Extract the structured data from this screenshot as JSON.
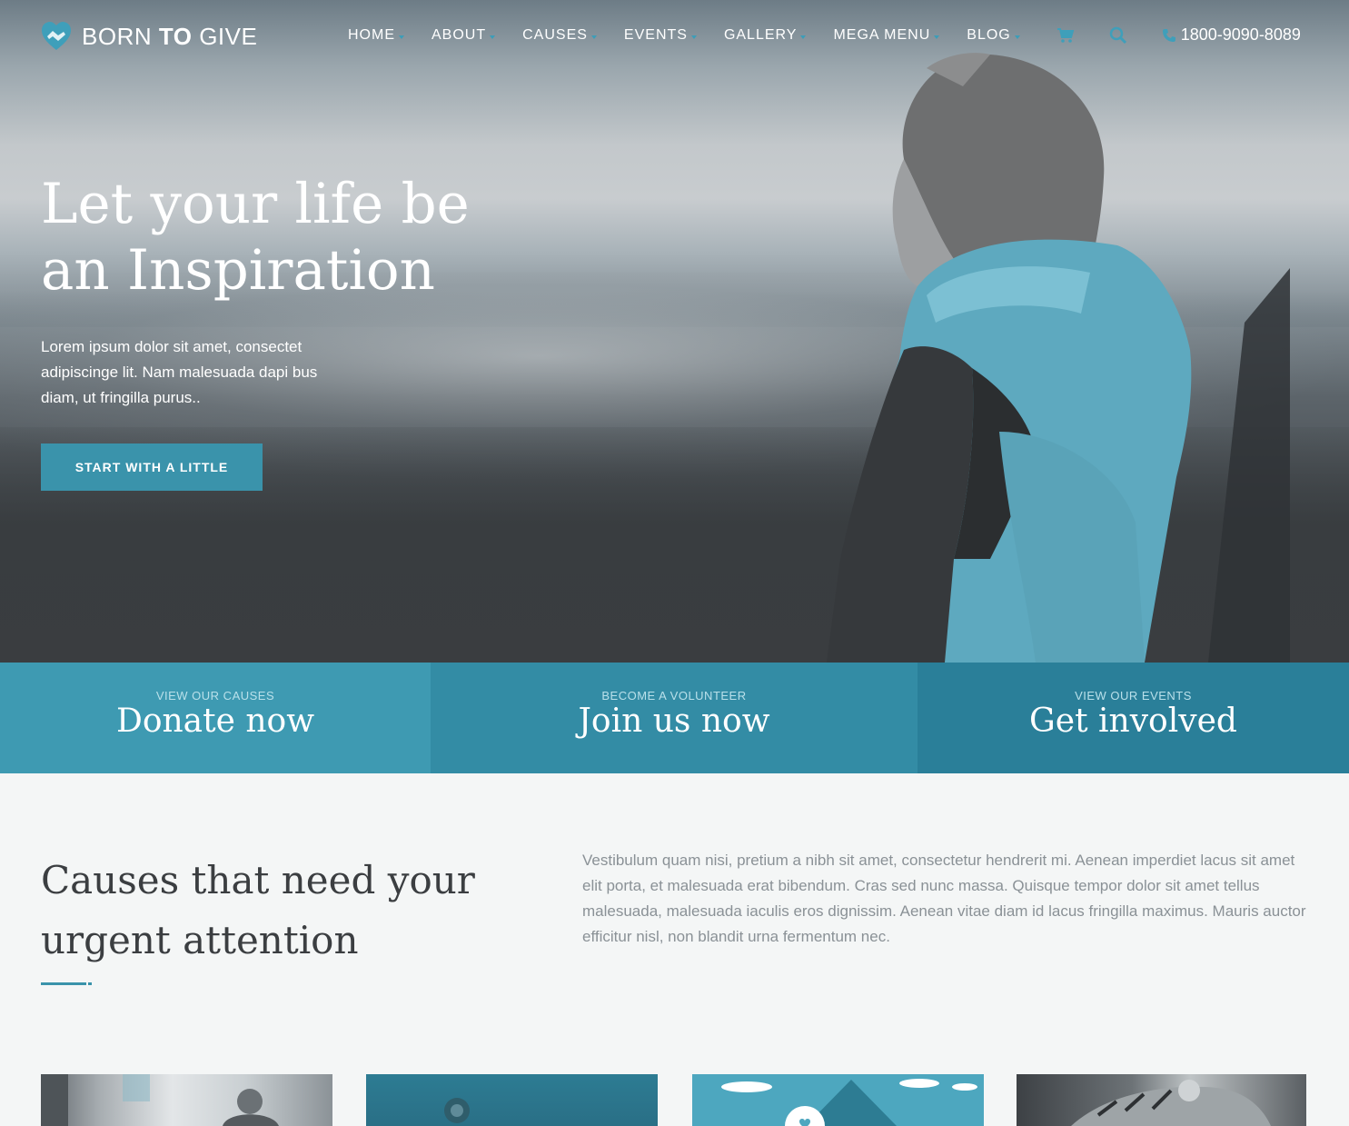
{
  "brand": {
    "name_light": "BORN ",
    "name_bold": "TO",
    "name_end": " GIVE",
    "accent_color": "#3a93ab"
  },
  "nav": {
    "items": [
      {
        "label": "HOME"
      },
      {
        "label": "ABOUT"
      },
      {
        "label": "CAUSES"
      },
      {
        "label": "EVENTS"
      },
      {
        "label": "GALLERY"
      },
      {
        "label": "MEGA MENU"
      },
      {
        "label": "BLOG"
      }
    ],
    "cart_icon": "cart-icon",
    "search_icon": "search-icon",
    "phone_icon": "phone-icon",
    "phone": "1800-9090-8089"
  },
  "hero": {
    "title_line1": "Let your life be",
    "title_line2": "an Inspiration",
    "text": "Lorem ipsum dolor sit amet, consectet adipiscinge lit. Nam malesuada dapi bus diam, ut fringilla purus..",
    "button": "START WITH A LITTLE"
  },
  "cta": [
    {
      "sub": "VIEW OUR CAUSES",
      "big": "Donate now"
    },
    {
      "sub": "BECOME A VOLUNTEER",
      "big": "Join us now"
    },
    {
      "sub": "VIEW OUR EVENTS",
      "big": "Get involved"
    }
  ],
  "causes": {
    "title_line1": "Causes that need your",
    "title_line2": "urgent attention",
    "text": "Vestibulum quam nisi, pretium a nibh sit amet, consectetur hendrerit mi. Aenean imperdiet lacus sit amet elit porta, et malesuada erat bibendum. Cras sed nunc massa. Quisque tempor dolor sit amet tellus malesuada, malesuada iaculis eros dignissim. Aenean vitae diam id lacus fringilla maximus. Mauris auctor efficitur nisl, non blandit urna fermentum nec."
  }
}
